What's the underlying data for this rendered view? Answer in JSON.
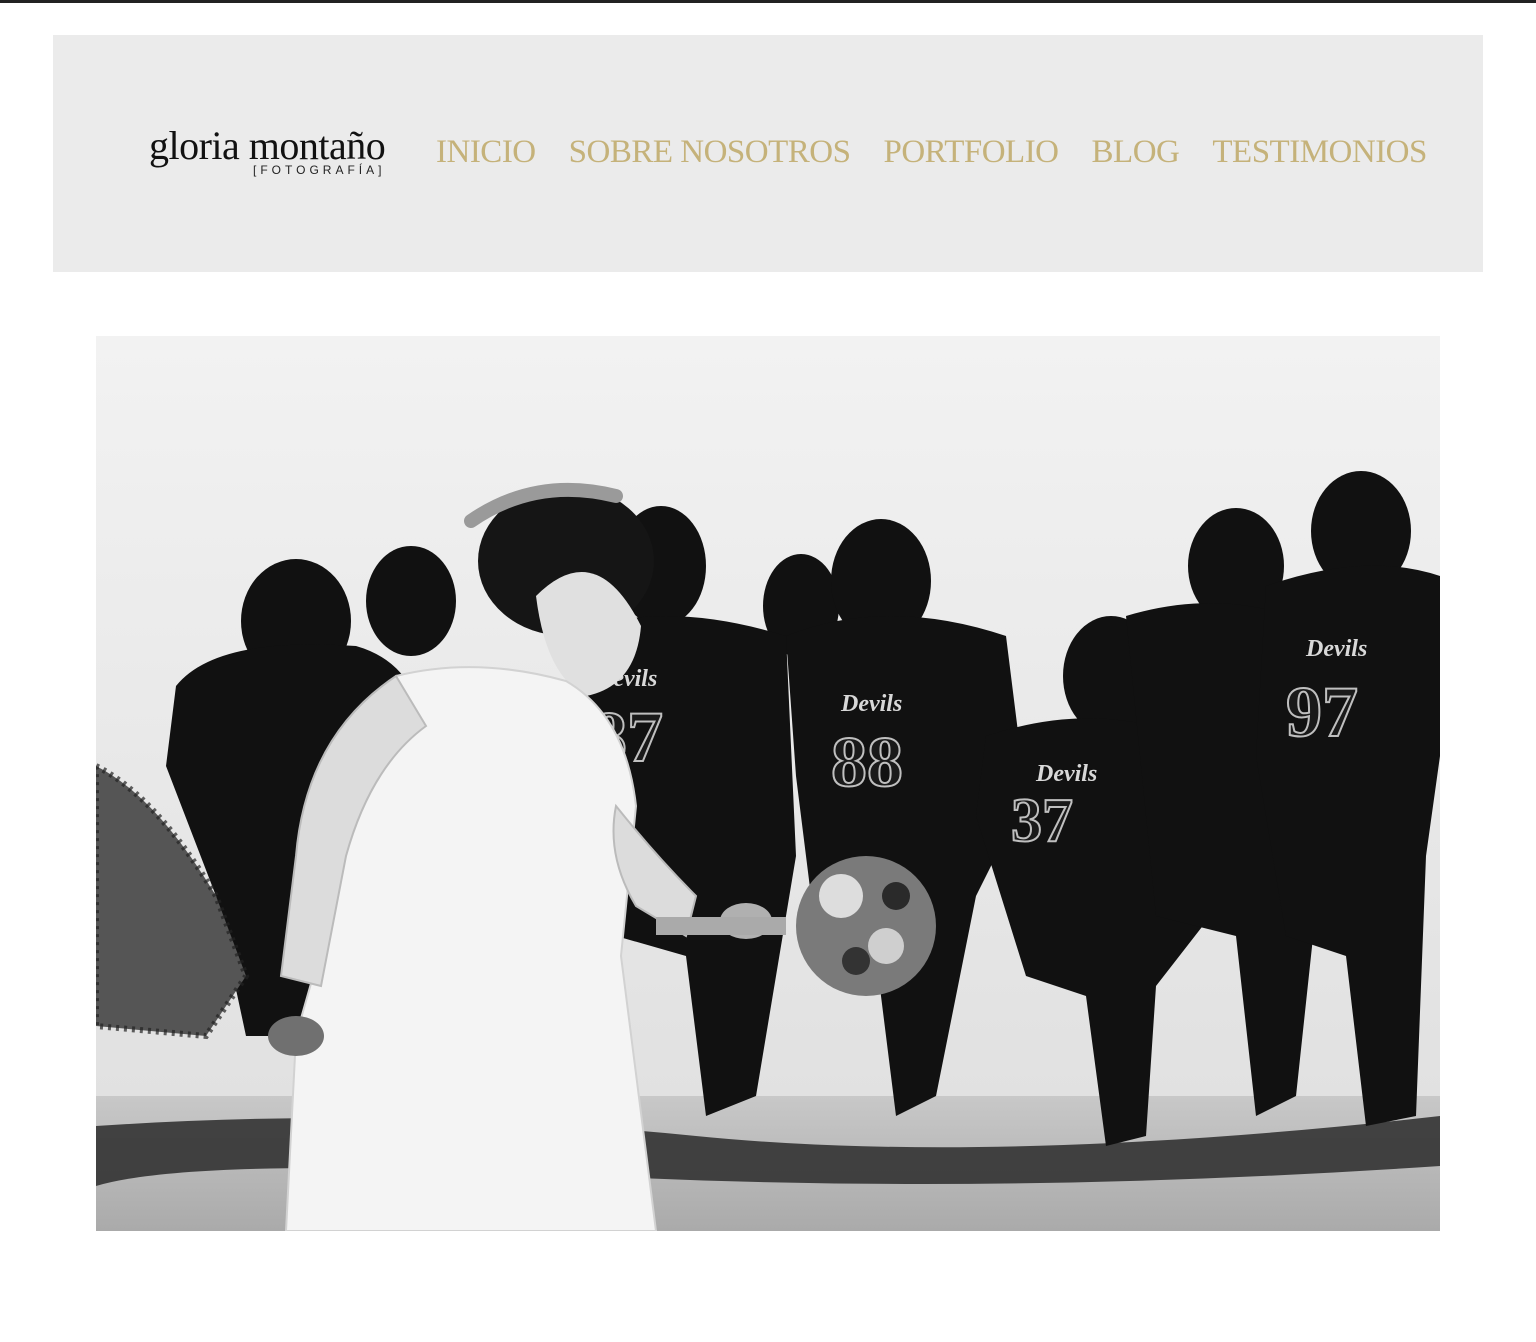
{
  "logo": {
    "name": "gloria montaño",
    "tagline": "[FOTOGRAFÍA]"
  },
  "nav": {
    "items": [
      {
        "label": "INICIO"
      },
      {
        "label": "SOBRE NOSOTROS"
      },
      {
        "label": "PORTFOLIO"
      },
      {
        "label": "BLOG"
      },
      {
        "label": "TESTIMONIOS"
      }
    ]
  },
  "hero": {
    "jersey_text": "Devils",
    "jersey_numbers": [
      "87",
      "88",
      "37",
      "97"
    ]
  },
  "colors": {
    "nav": "#c5b27a",
    "header_bg": "#ebebeb",
    "topline": "#222222"
  }
}
